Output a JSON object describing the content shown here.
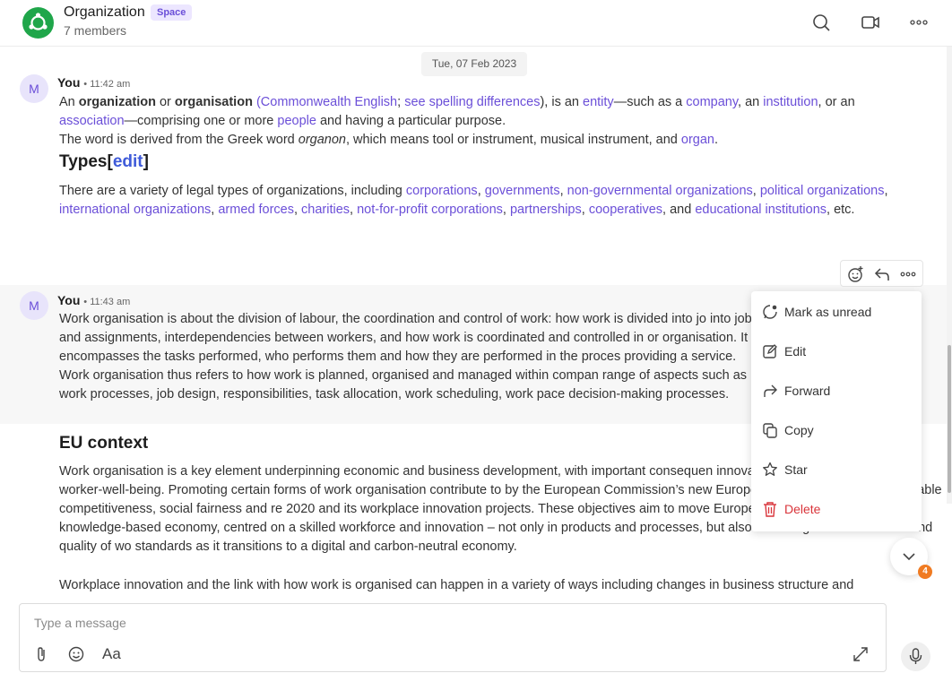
{
  "header": {
    "title": "Organization",
    "badge": "Space",
    "members": "7 members",
    "icons": [
      "logo-icon",
      "search-icon",
      "video-call-icon",
      "more-icon"
    ]
  },
  "date_divider": "Tue, 07 Feb 2023",
  "messages": [
    {
      "avatar": "M",
      "sender": "You",
      "time": "• 11:42 am",
      "p1": [
        {
          "t": "An "
        },
        {
          "t": "organization",
          "b": true
        },
        {
          "t": " or "
        },
        {
          "t": "organisation",
          "b": true
        },
        {
          "t": " "
        },
        {
          "t": "(Commonwealth English",
          "l": true
        },
        {
          "t": "; "
        },
        {
          "t": "see spelling differences",
          "l": true
        },
        {
          "t": "), is an ",
          "l2": true
        },
        {
          "t": "entity",
          "l": true
        },
        {
          "t": "—such as a "
        },
        {
          "t": "company",
          "l": true
        },
        {
          "t": ", an "
        },
        {
          "t": "institution",
          "l": true
        },
        {
          "t": ", or an "
        },
        {
          "t": "association",
          "l": true
        },
        {
          "t": "—comprising one or more "
        },
        {
          "t": "people",
          "l": true
        },
        {
          "t": " and having a particular purpose."
        }
      ],
      "p2": [
        {
          "t": "The word is derived from the Greek word "
        },
        {
          "t": "organon",
          "i": true
        },
        {
          "t": ", which means tool or instrument, musical instrument, and "
        },
        {
          "t": "organ",
          "l": true
        },
        {
          "t": "."
        }
      ],
      "heading": "Types",
      "heading_bracket_open": "[",
      "heading_link": "edit",
      "heading_bracket_close": "]",
      "p3": [
        {
          "t": "There are a variety of legal types of organizations, including "
        },
        {
          "t": "corporations",
          "l": true
        },
        {
          "t": ", "
        },
        {
          "t": "governments",
          "l": true
        },
        {
          "t": ", "
        },
        {
          "t": "non-governmental organizations",
          "l": true
        },
        {
          "t": ", "
        },
        {
          "t": "political organizations",
          "l": true
        },
        {
          "t": ", "
        },
        {
          "t": "international organizations",
          "l": true
        },
        {
          "t": ", "
        },
        {
          "t": "armed forces",
          "l": true
        },
        {
          "t": ", "
        },
        {
          "t": "charities",
          "l": true
        },
        {
          "t": ", "
        },
        {
          "t": "not-for-profit corporations",
          "l": true
        },
        {
          "t": ", "
        },
        {
          "t": "partnerships",
          "l": true
        },
        {
          "t": ", "
        },
        {
          "t": "cooperatives",
          "l": true
        },
        {
          "t": ", and "
        },
        {
          "t": "educational institutions",
          "l": true
        },
        {
          "t": ", etc."
        }
      ]
    },
    {
      "avatar": "M",
      "sender": "You",
      "time": "• 11:43 am",
      "p1": "Work organisation is about the division of labour, the coordination and control of work: how work is divided into jo into jobs and assignments, interdependencies between workers, and how work is coordinated and controlled in or organisation. It encompasses the tasks performed, who performs them and how they are performed in the proces providing a service. Work organisation thus refers to how work is planned, organised and managed within compan range of aspects such as work processes, job design, responsibilities, task allocation, work scheduling, work pace decision-making processes.",
      "heading": "EU context",
      "p2": "Work organisation is a key element underpinning economic and business development, with important consequen innovation, working conditions and worker-well-being. Promoting certain forms of work organisation contribute to by the European Commission’s new European Skills Agenda for sustainable competitiveness, social fairness and re 2020 and its workplace innovation projects. These objectives aim to move Europe towards a more competitive knowledge-based economy, centred on a skilled workforce and innovation – not only in products and processes, but also in the organisation of work and quality of wo standards as it transitions to a digital and carbon-neutral economy.",
      "p3": "Workplace innovation and the link with how work is organised can happen in a variety of ways including changes in business structure and"
    }
  ],
  "message_actions": [
    "add-reaction-icon",
    "reply-icon",
    "more-actions-icon"
  ],
  "context_menu": [
    {
      "label": "Mark as unread",
      "icon": "mark-unread-icon"
    },
    {
      "label": "Edit",
      "icon": "edit-icon"
    },
    {
      "label": "Forward",
      "icon": "forward-icon"
    },
    {
      "label": "Copy",
      "icon": "copy-icon"
    },
    {
      "label": "Star",
      "icon": "star-icon"
    },
    {
      "label": "Delete",
      "icon": "delete-icon",
      "color": "#d9343a"
    }
  ],
  "jump_to_latest": {
    "count": "4",
    "badge_color": "#f07b22"
  },
  "composer": {
    "placeholder": "Type a message",
    "format_label": "Aa",
    "icons": [
      "attach-icon",
      "emoji-icon",
      "expand-icon",
      "microphone-icon"
    ]
  },
  "colors": {
    "link": "#6b4fd8",
    "brand": "#1fa64a",
    "danger": "#d9343a"
  }
}
